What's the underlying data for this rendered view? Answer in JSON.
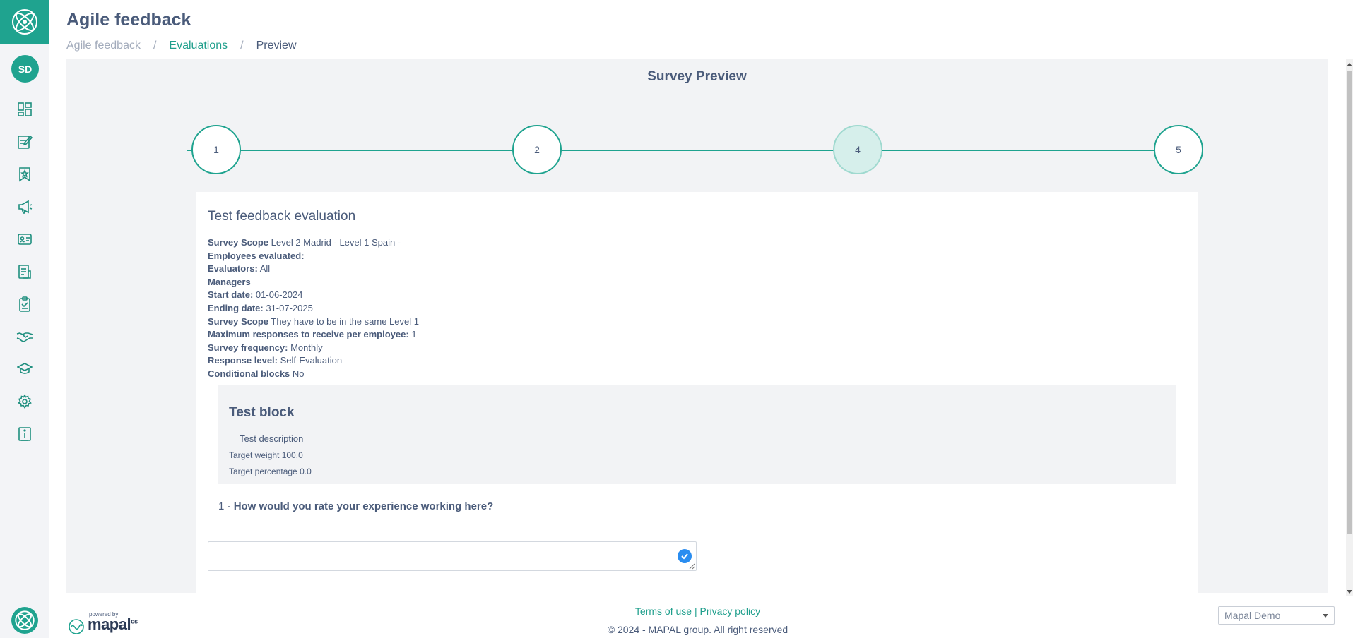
{
  "app": {
    "title": "Agile feedback",
    "user_initials": "SD",
    "accent_color": "#1fa38f"
  },
  "breadcrumb": {
    "items": [
      "Agile feedback",
      "Evaluations",
      "Preview"
    ],
    "separator": "/"
  },
  "sidebar": {
    "icons": [
      "dashboard-icon",
      "edit-form-icon",
      "bookmark-star-icon",
      "megaphone-icon",
      "id-card-icon",
      "report-icon",
      "clipboard-check-icon",
      "handshake-icon",
      "graduation-cap-icon",
      "gear-icon",
      "info-icon"
    ]
  },
  "survey": {
    "heading": "Survey Preview",
    "steps": [
      "1",
      "2",
      "4",
      "5"
    ],
    "active_step": "4"
  },
  "evaluation": {
    "title": "Test feedback evaluation",
    "fields": [
      {
        "label": "Survey Scope",
        "value": "Level 2 Madrid - Level 1 Spain -"
      },
      {
        "label": "Employees evaluated:",
        "value": ""
      },
      {
        "label": "Evaluators:",
        "value": "All"
      },
      {
        "label": "Managers",
        "value": ""
      },
      {
        "label": "Start date:",
        "value": "01-06-2024"
      },
      {
        "label": "Ending date:",
        "value": "31-07-2025"
      },
      {
        "label": "Survey Scope",
        "value": "They have to be in the same Level 1"
      },
      {
        "label": "Maximum responses to receive per employee:",
        "value": "1"
      },
      {
        "label": "Survey frequency:",
        "value": "Monthly"
      },
      {
        "label": "Response level:",
        "value": "Self-Evaluation"
      },
      {
        "label": "Conditional blocks",
        "value": "No"
      }
    ]
  },
  "block": {
    "title": "Test block",
    "description": "Test description",
    "target_weight": "Target weight 100.0",
    "target_percentage": "Target percentage 0.0"
  },
  "question": {
    "number": "1 -",
    "text": "How would you rate your experience working here?",
    "answer_value": ""
  },
  "footer": {
    "terms": "Terms of use",
    "divider": "|",
    "privacy": "Privacy policy",
    "copyright": "© 2024 - MAPAL group. All right reserved",
    "powered_by": "powered by",
    "brand": "mapal",
    "brand_suffix": "os",
    "company_selected": "Mapal Demo"
  }
}
